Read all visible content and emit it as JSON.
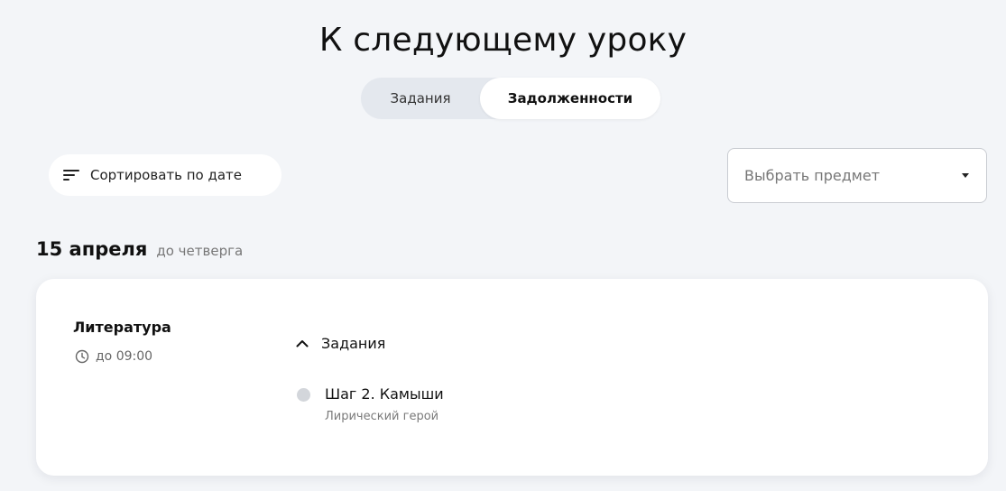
{
  "title": "К следующему уроку",
  "tabs": [
    {
      "label": "Задания",
      "active": false
    },
    {
      "label": "Задолженности",
      "active": true
    }
  ],
  "sort": {
    "label": "Сортировать по дате",
    "icon": "sort-icon"
  },
  "subject_select": {
    "placeholder": "Выбрать предмет",
    "icon": "caret-down-icon"
  },
  "group": {
    "date": "15 апреля",
    "due_note": "до четверга",
    "card": {
      "subject": "Литература",
      "deadline": "до 09:00",
      "section_label": "Задания",
      "tasks": [
        {
          "title": "Шаг 2. Камыши",
          "description": "Лирический герой",
          "status_color": "#d3d6db"
        }
      ]
    }
  }
}
